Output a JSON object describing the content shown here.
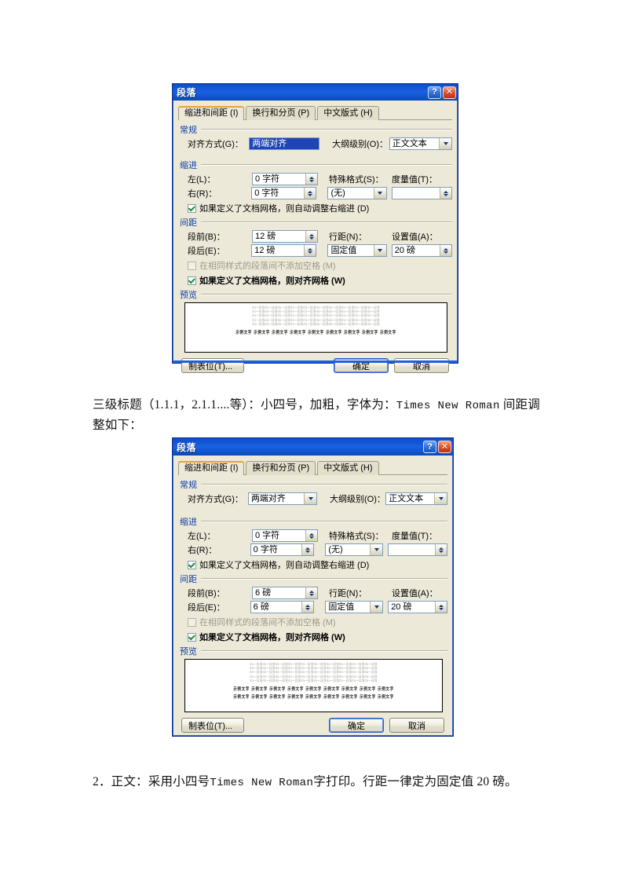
{
  "page": {
    "background": "#ffffff",
    "paragraph_heading3": "三级标题（1.1.1，2.1.1....等）：小四号，加粗，字体为：",
    "paragraph_heading3_roman": "Times New Roman",
    "paragraph_heading3_tail": "间距调整如下：",
    "paragraph_body_pre": "2．正文：采用小四号",
    "paragraph_body_roman": "Times  New  Roman",
    "paragraph_body_post": "字打印。行距一律定为固定值 20 磅。"
  },
  "colors": {
    "titlebar_blue": "#1256d6",
    "dialog_face": "#ece9d8",
    "group_label_blue": "#0b3ea8",
    "active_tab_accent": "#e8a32a",
    "selection_blue": "#1f44b8",
    "check_green": "#1f8b23",
    "close_red": "#e2502a"
  },
  "dialog1": {
    "title": "段落",
    "help_icon": "?",
    "close_icon": "✕",
    "tabs": [
      {
        "label": "缩进和间距 (I)",
        "active": true
      },
      {
        "label": "换行和分页 (P)",
        "active": false
      },
      {
        "label": "中文版式 (H)",
        "active": false
      }
    ],
    "general": {
      "group_label": "常规",
      "alignment_label": "对齐方式(G)：",
      "alignment_value": "两端对齐",
      "alignment_selected": true,
      "outline_label": "大纲级别(O)：",
      "outline_value": "正文文本"
    },
    "indent": {
      "group_label": "缩进",
      "left_label": "左(L)：",
      "left_value": "0 字符",
      "right_label": "右(R)：",
      "right_value": "0 字符",
      "special_label": "特殊格式(S)：",
      "special_value": "(无)",
      "measure_label": "度量值(T)：",
      "measure_value": "",
      "auto_adjust_checkbox": "如果定义了文档网格，则自动调整右缩进 (D)",
      "auto_adjust_checked": true
    },
    "spacing": {
      "group_label": "间距",
      "before_label": "段前(B)：",
      "before_value": "12 磅",
      "after_label": "段后(E)：",
      "after_value": "12 磅",
      "linespacing_label": "行距(N)：",
      "linespacing_value": "固定值",
      "setvalue_label": "设置值(A)：",
      "setvalue_value": "20 磅",
      "no_space_same_style": "在相同样式的段落间不添加空格 (M)",
      "no_space_checked": false,
      "no_space_disabled": true,
      "snap_to_grid": "如果定义了文档网格，则对齐网格 (W)",
      "snap_to_grid_checked": true
    },
    "preview": {
      "group_label": "预览",
      "filler_line": "da一段落da一段落da一段落da一段落da一段落da一段落da一段落da一段落da一段落da一段落",
      "filler_line_count": 5,
      "sample_line": "示例文字 示例文字 示例文字 示例文字 示例文字 示例文字 示例文字 示例文字 示例文字",
      "sample_line_count": 1
    },
    "buttons": {
      "tabstop": "制表位(T)...",
      "ok": "确定",
      "cancel": "取消"
    }
  },
  "dialog2": {
    "title": "段落",
    "help_icon": "?",
    "close_icon": "✕",
    "tabs": [
      {
        "label": "缩进和间距 (I)",
        "active": true
      },
      {
        "label": "换行和分页 (P)",
        "active": false
      },
      {
        "label": "中文版式 (H)",
        "active": false
      }
    ],
    "general": {
      "group_label": "常规",
      "alignment_label": "对齐方式(G)：",
      "alignment_value": "两端对齐",
      "alignment_selected": false,
      "outline_label": "大纲级别(O)：",
      "outline_value": "正文文本"
    },
    "indent": {
      "group_label": "缩进",
      "left_label": "左(L)：",
      "left_value": "0 字符",
      "right_label": "右(R)：",
      "right_value": "0 字符",
      "special_label": "特殊格式(S)：",
      "special_value": "(无)",
      "measure_label": "度量值(T)：",
      "measure_value": "",
      "auto_adjust_checkbox": "如果定义了文档网格，则自动调整右缩进 (D)",
      "auto_adjust_checked": true
    },
    "spacing": {
      "group_label": "间距",
      "before_label": "段前(B)：",
      "before_value": "6 磅",
      "after_label": "段后(E)：",
      "after_value": "6 磅",
      "linespacing_label": "行距(N)：",
      "linespacing_value": "固定值",
      "setvalue_label": "设置值(A)：",
      "setvalue_value": "20 磅",
      "no_space_same_style": "在相同样式的段落间不添加空格 (M)",
      "no_space_checked": false,
      "no_space_disabled": true,
      "snap_to_grid": "如果定义了文档网格，则对齐网格 (W)",
      "snap_to_grid_checked": true
    },
    "preview": {
      "group_label": "预览",
      "filler_line": "da一段落da一段落da一段落da一段落da一段落da一段落da一段落da一段落da一段落da一段落",
      "filler_line_count": 5,
      "sample_line": "示例文字 示例文字 示例文字 示例文字 示例文字 示例文字 示例文字 示例文字 示例文字",
      "sample_line_count": 2
    },
    "buttons": {
      "tabstop": "制表位(T)...",
      "ok": "确定",
      "cancel": "取消"
    }
  }
}
